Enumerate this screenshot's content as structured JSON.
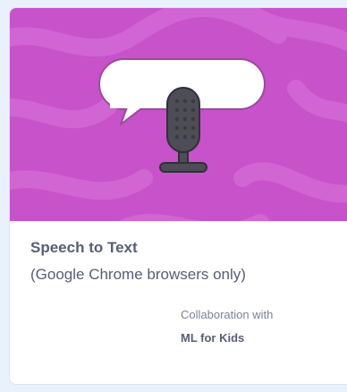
{
  "extension_card": {
    "title": "Speech to Text",
    "description": "(Google Chrome browsers only)",
    "collaboration_label": "Collaboration with",
    "collaborator": "ML for Kids",
    "icon": "speech-bubble-microphone-icon",
    "colors": {
      "banner": "#c852c9",
      "banner_swirl": "#d36bd4",
      "text_primary": "#575e75",
      "text_secondary": "#7d8299",
      "page_background": "#e9f1fc"
    }
  }
}
